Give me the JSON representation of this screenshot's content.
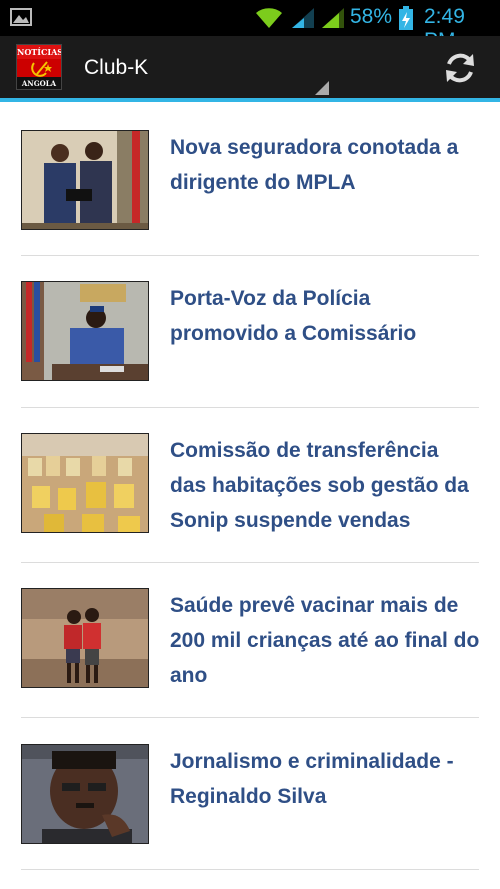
{
  "status_bar": {
    "battery_percent": "58%",
    "time": "2:49",
    "time_suffix": "PM",
    "icons": [
      "gallery-icon",
      "wifi-icon",
      "signal-icon",
      "signal-icon",
      "battery-charging-icon"
    ]
  },
  "action_bar": {
    "logo_top": "NOTÍCIAS",
    "logo_bottom": "ANGOLA",
    "title": "Club-K",
    "refresh_icon": "refresh-icon"
  },
  "colors": {
    "accent": "#33b5e5",
    "headline": "#2f4f86",
    "action_bar_bg": "#1b1b1b"
  },
  "news": [
    {
      "headline": "Nova seguradora conotada a dirigente do MPLA",
      "thumb": "officials-shaking-hands"
    },
    {
      "headline": "Porta-Voz da Polícia promovido a Comissário",
      "thumb": "police-officer-at-desk"
    },
    {
      "headline": "Comissão de transferência das habitações sob gestão da Sonip suspende vendas",
      "thumb": "housing-development-aerial"
    },
    {
      "headline": "Saúde prevê vacinar mais de 200 mil crianças até ao final do ano",
      "thumb": "two-children-walking"
    },
    {
      "headline": "Jornalismo e criminalidade - Reginaldo Silva",
      "thumb": "man-portrait"
    }
  ]
}
